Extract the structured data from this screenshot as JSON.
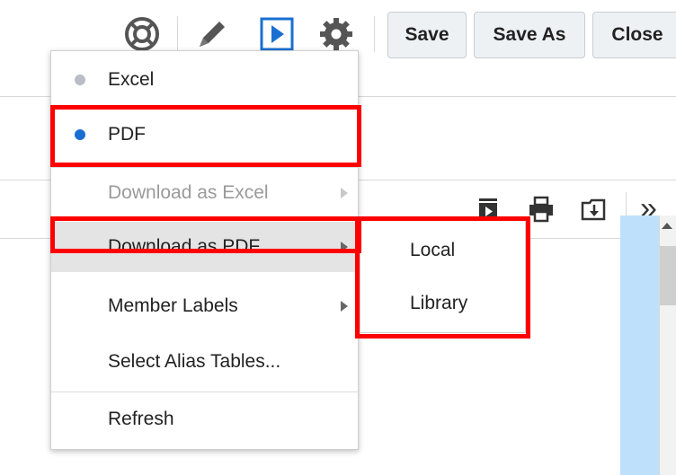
{
  "toolbar": {
    "icons": [
      "help-icon",
      "edit-icon",
      "run-icon",
      "settings-icon"
    ],
    "save_label": "Save",
    "save_as_label": "Save As",
    "close_label": "Close"
  },
  "secondary_toolbar": {
    "icons": [
      "export-icon",
      "print-icon",
      "import-icon"
    ],
    "overflow_label": "»"
  },
  "menu": {
    "format_options": [
      {
        "label": "Excel",
        "selected": false
      },
      {
        "label": "PDF",
        "selected": true
      }
    ],
    "items": [
      {
        "label": "Download as Excel",
        "disabled": true
      },
      {
        "label": "Download as PDF",
        "disabled": false
      },
      {
        "label": "Member Labels",
        "disabled": false
      },
      {
        "label": "Select Alias Tables...",
        "disabled": false
      },
      {
        "label": "Refresh",
        "disabled": false
      }
    ]
  },
  "submenu": {
    "items": [
      {
        "label": "Local"
      },
      {
        "label": "Library"
      }
    ]
  },
  "colors": {
    "accent": "#1a6fd1",
    "highlight": "#ff0000",
    "disabled_text": "#9a9a9a"
  }
}
